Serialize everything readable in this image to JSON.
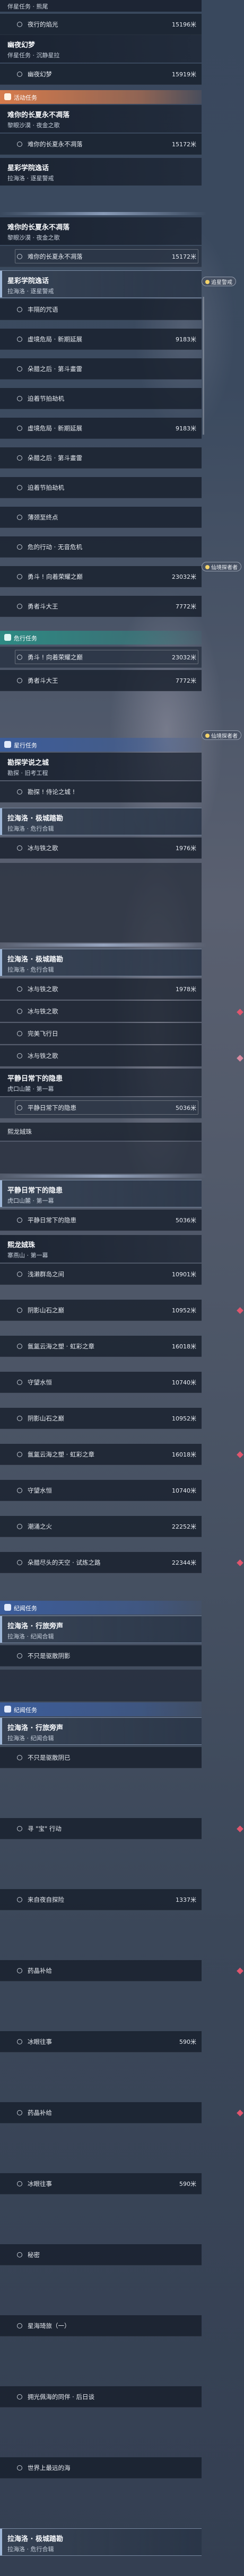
{
  "top_strip": "伴星任务 · 熊尾",
  "s1": {
    "sub_flight": "夜行的焰光",
    "sub_flight_dist": "15196米",
    "title": "幽夜幻梦",
    "subtitle": "伴星任务 · 沉静星拉",
    "sub_dream": "幽夜幻梦",
    "sub_dream_dist": "15919米"
  },
  "headers": {
    "activity": "活动任务",
    "danger": "危行任务",
    "star": "星行任务",
    "legend": "纪闻任务"
  },
  "quest": {
    "eternal_title": "难你的长夏永不凋落",
    "eternal_sub": "黎眼沙漠 · 夜金之歌",
    "eternal_row": "难你的长夏永不凋落",
    "eternal_dist": "15172米",
    "academy_title": "星彩学院逸话",
    "academy_sub": "拉海洛 · 逐星警戒",
    "academy_sub2": "拉海洛 · 逐星警戒"
  },
  "academy_rows": [
    {
      "label": "丰隔的咒语",
      "dist": ""
    },
    {
      "label": "虚境危局 · 新期延展",
      "dist": "9183米"
    },
    {
      "label": "朵腊之后 · 第斗畫雷",
      "dist": ""
    },
    {
      "label": "迫着节拍劫机",
      "dist": ""
    },
    {
      "label": "虚境危局 · 新期延展",
      "dist": "9183米"
    },
    {
      "label": "朵腊之后 · 第斗畫雷",
      "dist": ""
    },
    {
      "label": "迫着节拍劫机",
      "dist": ""
    },
    {
      "label": "薄颈至终点",
      "dist": ""
    },
    {
      "label": "危的行动 · 无音危机",
      "dist": ""
    },
    {
      "label": "勇斗 ! 向着荣耀之巅",
      "dist": "23032米"
    },
    {
      "label": "勇者斗大王",
      "dist": "7772米"
    }
  ],
  "chip_star": "追星警戒",
  "chip_star2": "仙境探者者",
  "chip_star3": "仙境探者者",
  "danger_rows": [
    {
      "label": "勇斗 ! 向着荣耀之巅",
      "dist": "23032米"
    },
    {
      "label": "勇者斗大王",
      "dist": "7772米"
    }
  ],
  "explore": {
    "title": "勘探学说之城",
    "subtitle": "勘探 · 旧考工程",
    "row": "勘探 ! 侍论之城 !"
  },
  "tower": {
    "title": "拉海洛 · 极城踏勘",
    "subtitle": "拉海洛 · 危行合辑",
    "row1": "冰与铁之歌",
    "row1_dist": "1976米",
    "title2": "拉海洛 · 极城踏勘",
    "subtitle2": "拉海洛 · 危行合辑",
    "row2a": "冰与铁之歌",
    "row2a_dist": "1978米",
    "row2b": "冰与铁之歌",
    "row2b_dist": "",
    "row2c": "完美飞行日",
    "row2d": "冰与铁之歌"
  },
  "peace": {
    "title": "平静日常下的隐患",
    "subtitle": "虎口山麓 · 第一幕",
    "row": "平静日常下的隐患",
    "dist": "5036米",
    "title2": "平静日常下的隐患",
    "subtitle2": "虎口山麓 · 第一幕",
    "row2": "平静日常下的隐患",
    "dist2": "5036米"
  },
  "drag": {
    "header1": "熙龙娀珠",
    "title": "熙龙娀珠",
    "subtitle": "寨燕山 · 第一幕",
    "rows": [
      {
        "label": "浅濑群岛之间",
        "dist": "10901米"
      },
      {
        "label": "阴影山石之巅",
        "dist": "10952米"
      },
      {
        "label": "氤氲云海之塑 · 虹彩之章",
        "dist": "16018米"
      },
      {
        "label": "守望水恒",
        "dist": "10740米"
      },
      {
        "label": "阴影山石之巅",
        "dist": "10952米"
      },
      {
        "label": "氤氲云海之塑 · 虹彩之章",
        "dist": "16018米"
      },
      {
        "label": "守望水恒",
        "dist": "10740米"
      },
      {
        "label": "潮涌之火",
        "dist": "22252米"
      },
      {
        "label": "朵腊尽头的天空 · 试炼之路",
        "dist": "22344米"
      }
    ]
  },
  "legend": {
    "title": "拉海洛 · 行旅旁声",
    "subtitle": "拉海洛 · 纪闻合辑",
    "row_top": "不只是驱散阴影",
    "title2": "拉海洛 · 行旅旁声",
    "subtitle2": "拉海洛 · 纪闻合辑",
    "rows": [
      {
        "label": "不只是驱散阴已",
        "dist": ""
      },
      {
        "label": "寻 \"宝\" 行动",
        "dist": ""
      },
      {
        "label": "来自夜自探险",
        "dist": "1337米"
      },
      {
        "label": "药晶补给",
        "dist": ""
      },
      {
        "label": "冰眼往事",
        "dist": "590米"
      },
      {
        "label": "药晶补给",
        "dist": ""
      },
      {
        "label": "冰眼往事",
        "dist": "590米"
      },
      {
        "label": "秘密",
        "dist": ""
      },
      {
        "label": "星海琦旅（一）",
        "dist": ""
      },
      {
        "label": "拥光佩海的同伴 · 后日谈",
        "dist": ""
      },
      {
        "label": "世界上最远的海",
        "dist": ""
      }
    ],
    "final_title": "拉海洛 · 极城踏勘",
    "final_sub": "拉海洛 · 危行合辑"
  }
}
